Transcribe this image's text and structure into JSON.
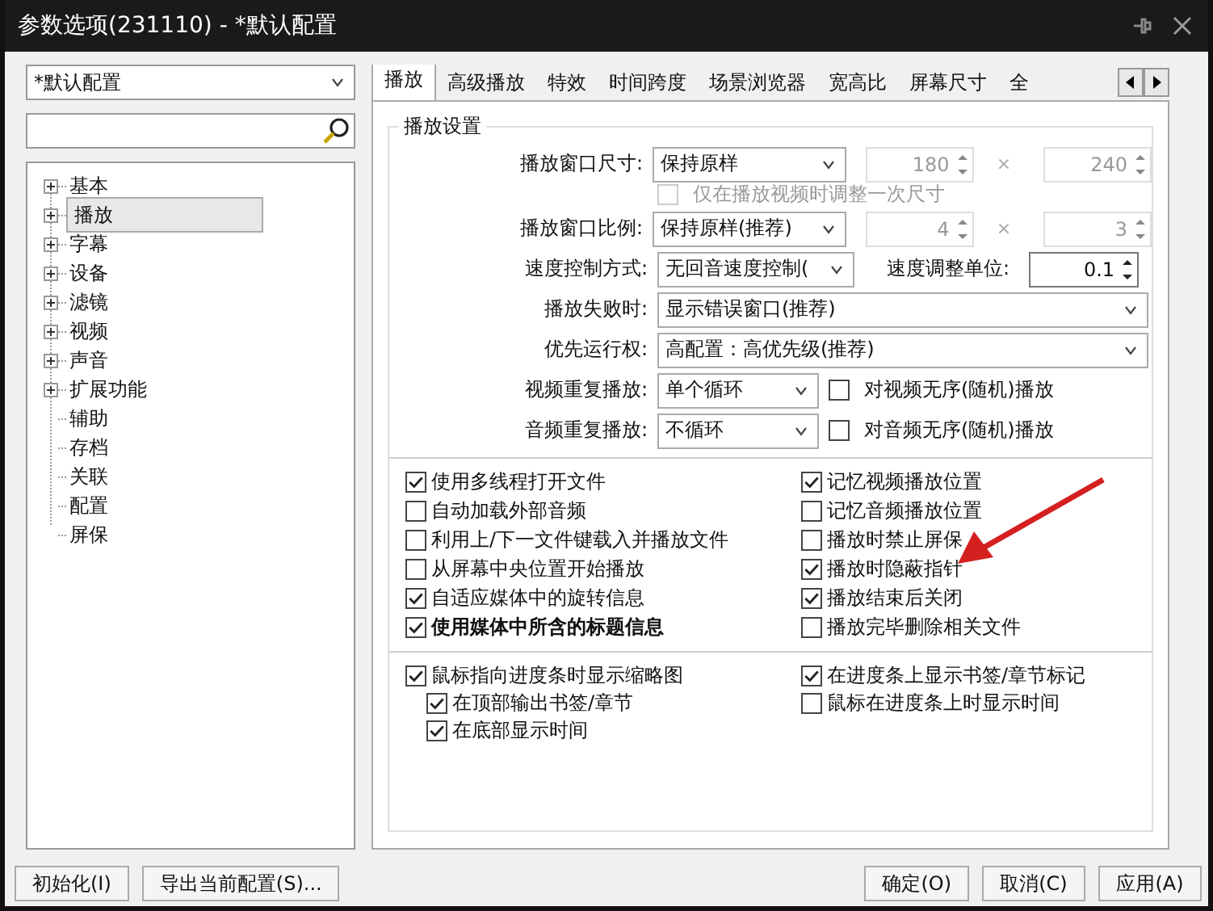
{
  "window": {
    "title": "参数选项(231110) - *默认配置"
  },
  "profile": {
    "value": "*默认配置"
  },
  "tree": [
    {
      "label": "基本",
      "kind": "group",
      "expanded": false,
      "selected": false
    },
    {
      "label": "播放",
      "kind": "group",
      "expanded": false,
      "selected": true
    },
    {
      "label": "字幕",
      "kind": "group",
      "expanded": false,
      "selected": false
    },
    {
      "label": "设备",
      "kind": "group",
      "expanded": false,
      "selected": false
    },
    {
      "label": "滤镜",
      "kind": "group",
      "expanded": false,
      "selected": false
    },
    {
      "label": "视频",
      "kind": "group",
      "expanded": false,
      "selected": false
    },
    {
      "label": "声音",
      "kind": "group",
      "expanded": false,
      "selected": false
    },
    {
      "label": "扩展功能",
      "kind": "group",
      "expanded": false,
      "selected": false
    },
    {
      "label": "辅助",
      "kind": "leaf",
      "selected": false
    },
    {
      "label": "存档",
      "kind": "leaf",
      "selected": false
    },
    {
      "label": "关联",
      "kind": "leaf",
      "selected": false
    },
    {
      "label": "配置",
      "kind": "leaf",
      "selected": false
    },
    {
      "label": "屏保",
      "kind": "leaf",
      "selected": false
    }
  ],
  "tabs": [
    {
      "label": "播放",
      "selected": true
    },
    {
      "label": "高级播放",
      "selected": false
    },
    {
      "label": "特效",
      "selected": false
    },
    {
      "label": "时间跨度",
      "selected": false
    },
    {
      "label": "场景浏览器",
      "selected": false
    },
    {
      "label": "宽高比",
      "selected": false
    },
    {
      "label": "屏幕尺寸",
      "selected": false
    },
    {
      "label": "全",
      "selected": false
    }
  ],
  "group": {
    "title": "播放设置",
    "rows": [
      {
        "kind": "size",
        "label": "播放窗口尺寸:",
        "select": "保持原样",
        "a": "180",
        "b": "240",
        "times": "×",
        "disabled": true
      },
      {
        "kind": "subcheck",
        "label": "仅在播放视频时调整一次尺寸",
        "checked": false,
        "disabled": true
      },
      {
        "kind": "size",
        "label": "播放窗口比例:",
        "select": "保持原样(推荐)",
        "a": "4",
        "b": "3",
        "times": "×",
        "disabled": true
      },
      {
        "kind": "speed",
        "label": "速度控制方式:",
        "select": "无回音速度控制(",
        "label2": "速度调整单位:",
        "value": "0.1"
      },
      {
        "kind": "wide",
        "label": "播放失败时:",
        "select": "显示错误窗口(推荐)"
      },
      {
        "kind": "wide",
        "label": "优先运行权:",
        "select": "高配置：高优先级(推荐)"
      },
      {
        "kind": "repeat",
        "label": "视频重复播放:",
        "select": "单个循环",
        "check": "对视频无序(随机)播放",
        "checked": false
      },
      {
        "kind": "repeat",
        "label": "音频重复播放:",
        "select": "不循环",
        "check": "对音频无序(随机)播放",
        "checked": false
      }
    ],
    "options": [
      {
        "label": "使用多线程打开文件",
        "checked": true,
        "bold": false
      },
      {
        "label": "记忆视频播放位置",
        "checked": true,
        "bold": false
      },
      {
        "label": "自动加载外部音频",
        "checked": false,
        "bold": false
      },
      {
        "label": "记忆音频播放位置",
        "checked": false,
        "bold": false
      },
      {
        "label": "利用上/下一文件键载入并播放文件",
        "checked": false,
        "bold": false
      },
      {
        "label": "播放时禁止屏保",
        "checked": false,
        "bold": false
      },
      {
        "label": "从屏幕中央位置开始播放",
        "checked": false,
        "bold": false
      },
      {
        "label": "播放时隐蔽指针",
        "checked": true,
        "bold": false
      },
      {
        "label": "自适应媒体中的旋转信息",
        "checked": true,
        "bold": false
      },
      {
        "label": "播放结束后关闭",
        "checked": true,
        "bold": false
      },
      {
        "label": "使用媒体中所含的标题信息",
        "checked": true,
        "bold": true
      },
      {
        "label": "播放完毕删除相关文件",
        "checked": false,
        "bold": false
      }
    ],
    "seek_left": [
      {
        "label": "鼠标指向进度条时显示缩略图",
        "checked": true,
        "children": [
          {
            "label": "在顶部输出书签/章节",
            "checked": true
          },
          {
            "label": "在底部显示时间",
            "checked": true
          }
        ]
      }
    ],
    "seek_right": [
      {
        "label": "在进度条上显示书签/章节标记",
        "checked": true
      },
      {
        "label": "鼠标在进度条上时显示时间",
        "checked": false
      }
    ]
  },
  "left_buttons": [
    "初始化(I)",
    "导出当前配置(S)..."
  ],
  "right_buttons": [
    "确定(O)",
    "取消(C)",
    "应用(A)"
  ]
}
